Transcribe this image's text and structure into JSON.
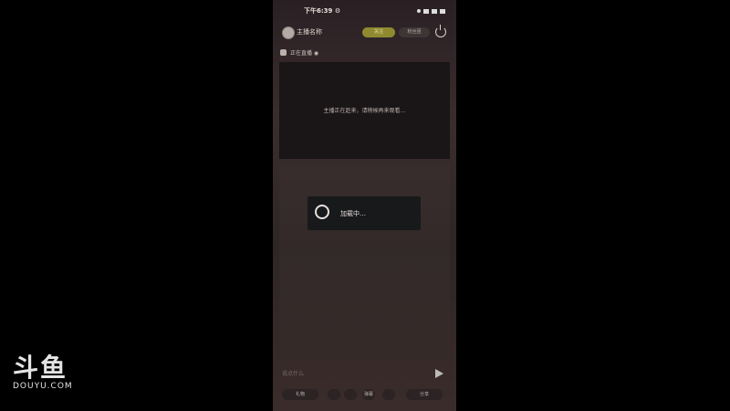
{
  "status": {
    "time": "下午6:39 ⚙"
  },
  "topbar": {
    "username": "主播名称",
    "pill_yellow": "关注",
    "pill_dark": "粉丝团"
  },
  "subrow": {
    "label": "正在直播 ◉"
  },
  "video": {
    "message": "主播正在赶来，请稍候再来观看…"
  },
  "toast": {
    "text": "加载中…"
  },
  "input": {
    "placeholder": "说点什么"
  },
  "bottombar": {
    "item1": "礼物",
    "item2": "弹幕",
    "item3": "分享"
  },
  "watermark": {
    "logo": "斗鱼",
    "domain": "DOUYU.COM"
  }
}
